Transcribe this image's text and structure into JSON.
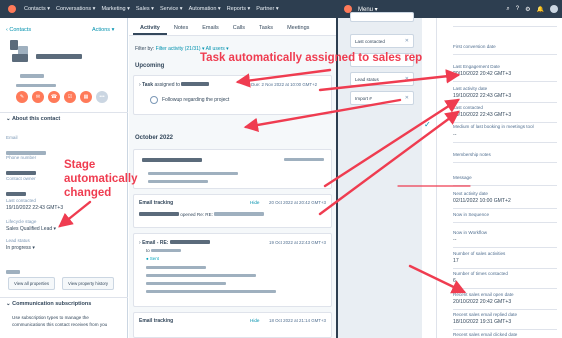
{
  "topnav": {
    "items": [
      "Contacts ▾",
      "Conversations ▾",
      "Marketing ▾",
      "Sales ▾",
      "Service ▾",
      "Automation ▾",
      "Reports ▾",
      "Partner ▾"
    ]
  },
  "contact": {
    "back_label": "‹ Contacts",
    "actions_label": "Actions ▾",
    "about_label": "About this contact",
    "email_label": "Email",
    "phone_label": "Phone number",
    "owner_label": "Contact owner",
    "last_contacted_label": "Last contacted",
    "last_contacted_value": "19/10/2022 22:43 GMT+3",
    "lifecycle_label": "Lifecycle stage",
    "lifecycle_value": "Sales Qualified Lead ▾",
    "lead_status_label": "Lead status",
    "lead_status_value": "In progress ▾",
    "view_all_props": "View all properties",
    "view_history": "View property history",
    "comm_sub_label": "Communication subscriptions",
    "comm_sub_text": "Use subscription types to manage the communications this contact receives from you"
  },
  "activity": {
    "tabs": [
      "Activity",
      "Notes",
      "Emails",
      "Calls",
      "Tasks",
      "Meetings"
    ],
    "filter_prefix": "Filter by:",
    "filter_value": "Filter activity (21/31) ▾",
    "users_value": "All users ▾",
    "upcoming_label": "Upcoming",
    "task_prefix": "Task",
    "task_assigned": "assigned to",
    "task_due": "Due: 2 Nov 2022 at 10:00 GMT+2",
    "task_title": "Followup regarding the project",
    "month_label": "October 2022",
    "email_tracking_label": "Email tracking",
    "hide_label": "Hide",
    "tracking_date_1": "20 Oct 2022 at 20:42 GMT+3",
    "opened_text": "opened Re: RE:",
    "email_re_label": "Email - RE:",
    "email_date": "19 Oct 2022 at 22:43 GMT+3",
    "email_to": "to",
    "sent_label": "Sent",
    "tracking_date_2": "18 Oct 2022 at 21:14 GMT+3"
  },
  "right": {
    "menu_label": "Menu ▾",
    "chips": [
      "Last contacted",
      "Lead status",
      "Import #"
    ],
    "props": [
      {
        "label": "First conversion date",
        "value": ""
      },
      {
        "label": "Last Engagement Date",
        "value": "20/10/2022 20:42 GMT+3"
      },
      {
        "label": "Last activity date",
        "value": "19/10/2022 22:43 GMT+3"
      },
      {
        "label": "Last contacted",
        "value": "19/10/2022 22:43 GMT+3"
      },
      {
        "label": "Medium of last booking in meetings tool",
        "value": "--"
      },
      {
        "label": "Membership notes",
        "value": ""
      },
      {
        "label": "Message",
        "value": ""
      },
      {
        "label": "Next activity date",
        "value": "02/11/2022 10:00 GMT+2"
      },
      {
        "label": "Now in Sequence",
        "value": ""
      },
      {
        "label": "Now in Workflow",
        "value": "--"
      },
      {
        "label": "Number of sales activities",
        "value": "17"
      },
      {
        "label": "Number of times contacted",
        "value": "6"
      },
      {
        "label": "Recent sales email open date",
        "value": "20/10/2022 20:42 GMT+3"
      },
      {
        "label": "Recent sales email replied date",
        "value": "18/10/2022 19:31 GMT+3"
      },
      {
        "label": "Recent sales email clicked date",
        "value": ""
      }
    ]
  },
  "annotations": {
    "task_note": "Task automatically assigned to sales rep",
    "stage_note_1": "Stage",
    "stage_note_2": "automatically",
    "stage_note_3": "changed"
  },
  "colors": {
    "annotation": "#ef3c50",
    "nav": "#2d3e50",
    "accent": "#ff7a59",
    "link": "#0091ae"
  }
}
